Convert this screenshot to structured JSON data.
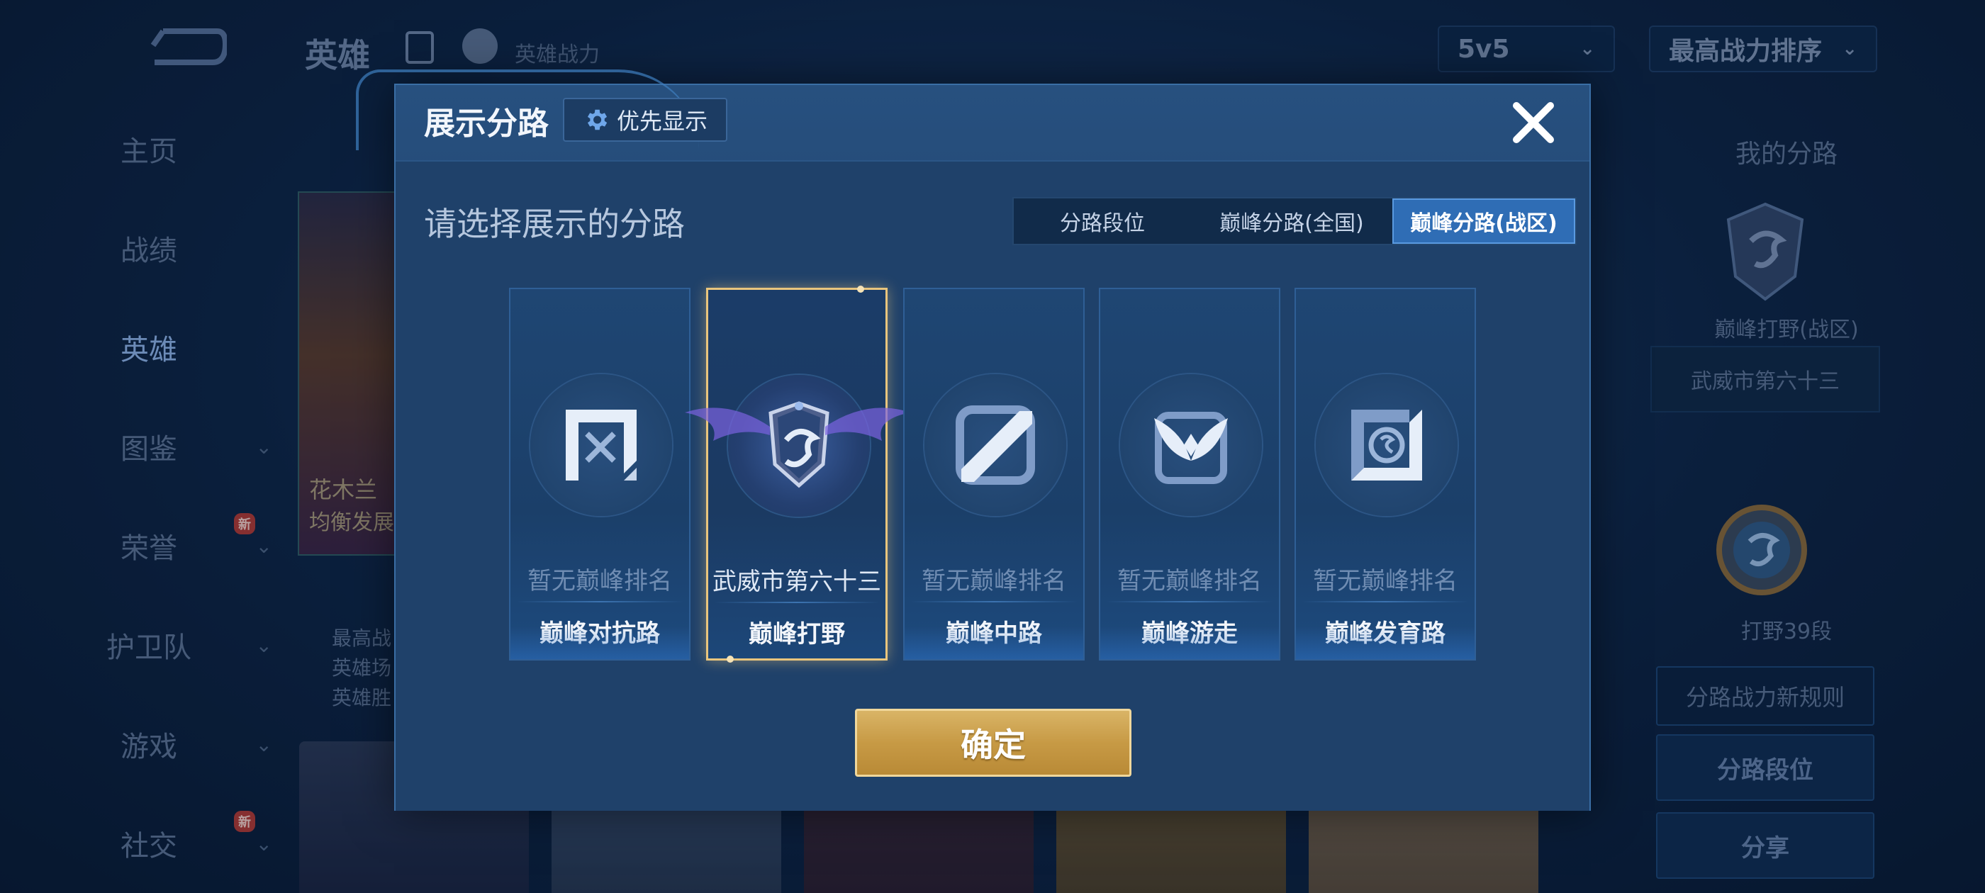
{
  "background": {
    "header": {
      "title": "英雄",
      "subtitle": "英雄战力",
      "mode_select": "5v5",
      "sort_select": "最高战力排序"
    },
    "nav": [
      {
        "label": "主页",
        "has_chevron": false
      },
      {
        "label": "战绩",
        "has_chevron": false
      },
      {
        "label": "英雄",
        "has_chevron": false,
        "active": true
      },
      {
        "label": "图鉴",
        "has_chevron": true
      },
      {
        "label": "荣誉",
        "has_chevron": true,
        "badge": "新"
      },
      {
        "label": "护卫队",
        "has_chevron": true
      },
      {
        "label": "游戏",
        "has_chevron": true
      },
      {
        "label": "社交",
        "has_chevron": true,
        "badge": "新"
      }
    ],
    "hero_card": {
      "name": "花木兰",
      "subtitle": "均衡发展",
      "stats": [
        "最高战",
        "英雄场",
        "英雄胜"
      ]
    },
    "right_panel": {
      "title": "我的分路",
      "emblem_label": "巅峰打野(战区)",
      "region_text": "武威市第六十三",
      "rank_label": "打野39段",
      "rule_button": "分路战力新规则",
      "segment_button": "分路段位",
      "share_button": "分享"
    }
  },
  "modal": {
    "title": "展示分路",
    "priority_button": "优先显示",
    "prompt": "请选择展示的分路",
    "tabs": [
      "分路段位",
      "巅峰分路(全国)",
      "巅峰分路(战区)"
    ],
    "active_tab": 2,
    "cards": [
      {
        "icon": "clash-lane-icon",
        "rank_text": "暂无巅峰排名",
        "name": "巅峰对抗路",
        "selected": false
      },
      {
        "icon": "jungle-emblem-icon",
        "rank_text": "武威市第六十三",
        "name": "巅峰打野",
        "selected": true
      },
      {
        "icon": "mid-lane-icon",
        "rank_text": "暂无巅峰排名",
        "name": "巅峰中路",
        "selected": false
      },
      {
        "icon": "roam-icon",
        "rank_text": "暂无巅峰排名",
        "name": "巅峰游走",
        "selected": false
      },
      {
        "icon": "farm-lane-icon",
        "rank_text": "暂无巅峰排名",
        "name": "巅峰发育路",
        "selected": false
      }
    ],
    "confirm_button": "确定"
  },
  "colors": {
    "accent_blue": "#2f6db5",
    "selected_border": "#e9c57d",
    "confirm_gold": "#c79a45",
    "modal_bg": "#21456f"
  }
}
